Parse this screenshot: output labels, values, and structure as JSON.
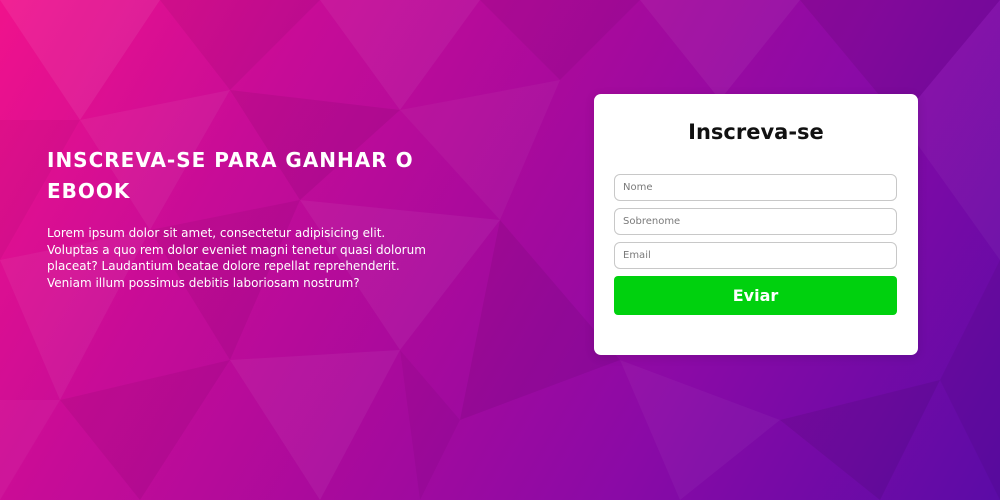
{
  "hero": {
    "title": "INSCREVA-SE PARA GANHAR O EBOOK",
    "text": "Lorem ipsum dolor sit amet, consectetur adipisicing elit. Voluptas a quo rem dolor eveniet magni tenetur quasi dolorum placeat? Laudantium beatae dolore repellat reprehenderit. Veniam illum possimus debitis laboriosam nostrum?"
  },
  "form": {
    "title": "Inscreva-se",
    "fields": [
      {
        "placeholder": "Nome",
        "value": ""
      },
      {
        "placeholder": "Sobrenome",
        "value": ""
      },
      {
        "placeholder": "Email",
        "value": ""
      }
    ],
    "submit_label": "Eviar"
  },
  "colors": {
    "background_start": "#f0128c",
    "background_end": "#5b0ba6",
    "submit_button": "#00d10e",
    "card": "#ffffff"
  }
}
